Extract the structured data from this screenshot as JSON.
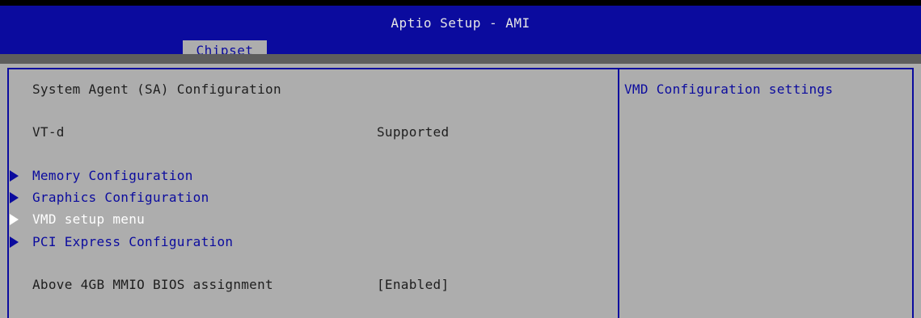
{
  "header": {
    "title": "Aptio Setup - AMI",
    "active_tab": "Chipset"
  },
  "main": {
    "section_title": "System Agent (SA) Configuration",
    "vtd": {
      "label": "VT-d",
      "value": "Supported"
    },
    "submenus": [
      {
        "label": "Memory Configuration",
        "selected": false
      },
      {
        "label": "Graphics Configuration",
        "selected": false
      },
      {
        "label": "VMD setup menu",
        "selected": true
      },
      {
        "label": "PCI Express Configuration",
        "selected": false
      }
    ],
    "mmio": {
      "label": "Above 4GB MMIO BIOS assignment",
      "value": "[Enabled]"
    }
  },
  "help": {
    "text": "VMD Configuration settings"
  },
  "colors": {
    "header_blue": "#0b0b9e",
    "panel_gray": "#adadad",
    "selected_text": "#ffffff",
    "normal_text": "#1e1e1e"
  },
  "icons": {
    "submenu_arrow": "right-triangle-icon"
  }
}
